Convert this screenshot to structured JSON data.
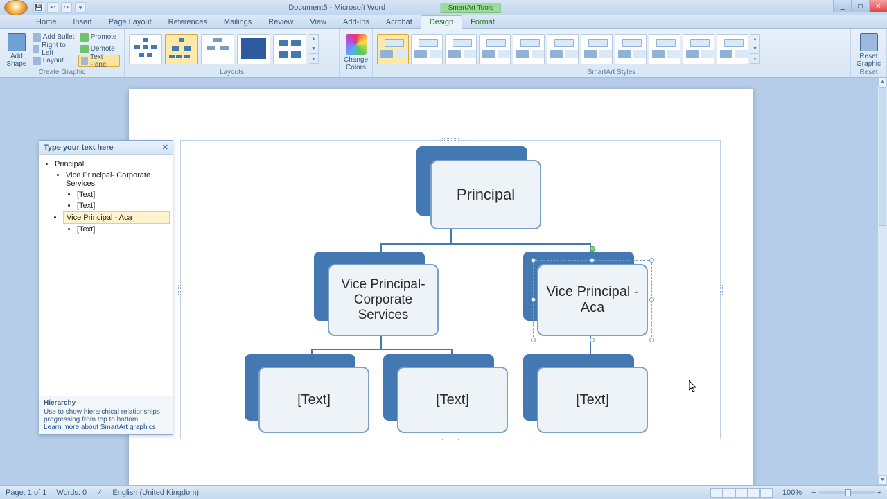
{
  "titlebar": {
    "doc_title": "Document5 - Microsoft Word",
    "context_tab_group": "SmartArt Tools"
  },
  "win": {
    "min": "_",
    "max": "□",
    "close": "✕"
  },
  "tabs": [
    "Home",
    "Insert",
    "Page Layout",
    "References",
    "Mailings",
    "Review",
    "View",
    "Add-Ins",
    "Acrobat"
  ],
  "context_tabs": {
    "design": "Design",
    "format": "Format"
  },
  "ribbon": {
    "create_graphic": {
      "label": "Create Graphic",
      "add_shape": "Add\nShape",
      "add_bullet": "Add Bullet",
      "right_to_left": "Right to Left",
      "layout": "Layout",
      "promote": "Promote",
      "demote": "Demote",
      "text_pane": "Text Pane"
    },
    "layouts": {
      "label": "Layouts"
    },
    "change_colors": "Change\nColors",
    "styles": {
      "label": "SmartArt Styles"
    },
    "reset": {
      "big": "Reset\nGraphic",
      "label": "Reset"
    }
  },
  "textpane": {
    "header": "Type your text here",
    "items": {
      "l0": "Principal",
      "l1a": "Vice Principal- Corporate Services",
      "l2a": "[Text]",
      "l2b": "[Text]",
      "l1b": "Vice Principal -  Aca",
      "l2c": "[Text]"
    },
    "footer_title": "Hierarchy",
    "footer_desc": "Use to show hierarchical relationships progressing from top to bottom.",
    "footer_link": "Learn more about SmartArt graphics"
  },
  "smartart": {
    "principal": "Principal",
    "vp1": "Vice Principal- Corporate Services",
    "vp2": "Vice Principal -  Aca",
    "leaf": "[Text]"
  },
  "statusbar": {
    "page": "Page: 1 of 1",
    "words": "Words: 0",
    "lang": "English (United Kingdom)",
    "zoom": "100%"
  }
}
